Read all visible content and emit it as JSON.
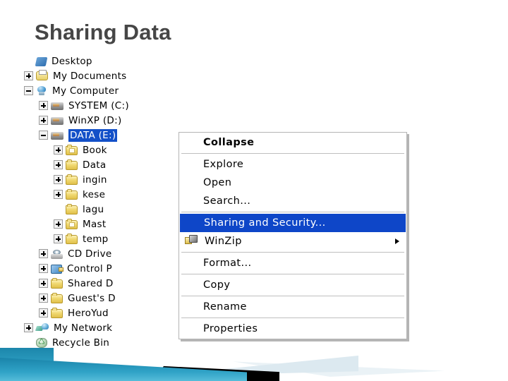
{
  "slide": {
    "title": "Sharing Data"
  },
  "tree": {
    "rows": [
      {
        "label": "Desktop",
        "indent": 0,
        "toggle": "none",
        "icon": "desktop-icon",
        "selected": false
      },
      {
        "label": "My Documents",
        "indent": 0,
        "toggle": "plus",
        "icon": "my-documents-icon",
        "selected": false
      },
      {
        "label": "My Computer",
        "indent": 0,
        "toggle": "minus",
        "icon": "my-computer-icon",
        "selected": false
      },
      {
        "label": "SYSTEM (C:)",
        "indent": 1,
        "toggle": "plus",
        "icon": "hard-drive-icon",
        "selected": false
      },
      {
        "label": "WinXP (D:)",
        "indent": 1,
        "toggle": "plus",
        "icon": "hard-drive-icon",
        "selected": false
      },
      {
        "label": "DATA (E:)",
        "indent": 1,
        "toggle": "minus",
        "icon": "hard-drive-icon",
        "selected": true
      },
      {
        "label": "Book",
        "indent": 2,
        "toggle": "plus",
        "icon": "folder-document-icon",
        "selected": false
      },
      {
        "label": "Data",
        "indent": 2,
        "toggle": "plus",
        "icon": "folder-icon",
        "selected": false
      },
      {
        "label": "ingin",
        "indent": 2,
        "toggle": "plus",
        "icon": "folder-icon",
        "selected": false
      },
      {
        "label": "kese",
        "indent": 2,
        "toggle": "plus",
        "icon": "folder-icon",
        "selected": false
      },
      {
        "label": "lagu",
        "indent": 2,
        "toggle": "none",
        "icon": "folder-icon",
        "selected": false
      },
      {
        "label": "Mast",
        "indent": 2,
        "toggle": "plus",
        "icon": "folder-document-icon",
        "selected": false
      },
      {
        "label": "temp",
        "indent": 2,
        "toggle": "plus",
        "icon": "folder-icon",
        "selected": false
      },
      {
        "label": "CD Drive",
        "indent": 1,
        "toggle": "plus",
        "icon": "cd-drive-icon",
        "selected": false
      },
      {
        "label": "Control P",
        "indent": 1,
        "toggle": "plus",
        "icon": "control-panel-icon",
        "selected": false
      },
      {
        "label": "Shared D",
        "indent": 1,
        "toggle": "plus",
        "icon": "folder-icon",
        "selected": false
      },
      {
        "label": "Guest's D",
        "indent": 1,
        "toggle": "plus",
        "icon": "folder-icon",
        "selected": false
      },
      {
        "label": "HeroYud",
        "indent": 1,
        "toggle": "plus",
        "icon": "folder-icon",
        "selected": false
      },
      {
        "label": "My Network",
        "indent": 0,
        "toggle": "plus",
        "icon": "network-icon",
        "selected": false
      },
      {
        "label": "Recycle Bin",
        "indent": 0,
        "toggle": "none",
        "icon": "recycle-bin-icon",
        "selected": false
      }
    ]
  },
  "context_menu": {
    "items": [
      {
        "label": "Collapse",
        "bold": true,
        "highlighted": false,
        "icon": null,
        "submenu": false,
        "separator_after": true
      },
      {
        "label": "Explore",
        "bold": false,
        "highlighted": false,
        "icon": null,
        "submenu": false,
        "separator_after": false
      },
      {
        "label": "Open",
        "bold": false,
        "highlighted": false,
        "icon": null,
        "submenu": false,
        "separator_after": false
      },
      {
        "label": "Search...",
        "bold": false,
        "highlighted": false,
        "icon": null,
        "submenu": false,
        "separator_after": true
      },
      {
        "label": "Sharing and Security...",
        "bold": false,
        "highlighted": true,
        "icon": null,
        "submenu": false,
        "separator_after": false
      },
      {
        "label": "WinZip",
        "bold": false,
        "highlighted": false,
        "icon": "winzip-icon",
        "submenu": true,
        "separator_after": true
      },
      {
        "label": "Format...",
        "bold": false,
        "highlighted": false,
        "icon": null,
        "submenu": false,
        "separator_after": true
      },
      {
        "label": "Copy",
        "bold": false,
        "highlighted": false,
        "icon": null,
        "submenu": false,
        "separator_after": true
      },
      {
        "label": "Rename",
        "bold": false,
        "highlighted": false,
        "icon": null,
        "submenu": false,
        "separator_after": true
      },
      {
        "label": "Properties",
        "bold": false,
        "highlighted": false,
        "icon": null,
        "submenu": false,
        "separator_after": false
      }
    ]
  },
  "colors": {
    "title": "#464646",
    "selection": "#1350c8",
    "menu_highlight": "#0e46c8",
    "deco_teal": "#2fa2c6",
    "deco_pale": "#dce9f0"
  }
}
